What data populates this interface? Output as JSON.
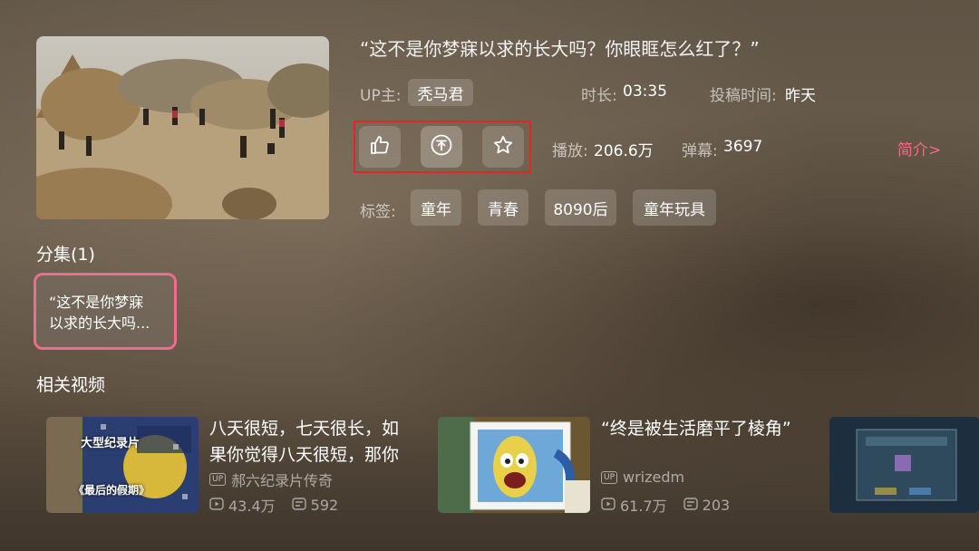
{
  "video": {
    "title": "“这不是你梦寐以求的长大吗？你眼眶怎么红了？”",
    "up_label": "UP主:",
    "up_name": "秃马君",
    "duration_label": "时长:",
    "duration": "03:35",
    "posted_label": "投稿时间:",
    "posted": "昨天",
    "plays_label": "播放:",
    "plays": "206.6万",
    "danmaku_label": "弹幕:",
    "danmaku": "3697",
    "intro_link": "简介>",
    "tags_label": "标签:",
    "tags": [
      "童年",
      "青春",
      "8090后",
      "童年玩具"
    ]
  },
  "actions": {
    "like_icon": "thumbs-up-icon",
    "coin_icon": "coin-icon",
    "favorite_icon": "star-icon"
  },
  "episodes": {
    "title": "分集(1)",
    "items": [
      {
        "line1": "“这不是你梦寐",
        "line2": "以求的长大吗..."
      }
    ]
  },
  "related": {
    "title": "相关视频",
    "items": [
      {
        "title_line1": "八天很短，七天很长，如",
        "title_line2": "果你觉得八天很短，那你",
        "up": "郝六纪录片传奇",
        "plays": "43.4万",
        "danmaku": "592",
        "thumb_text1": "大型纪录片",
        "thumb_text2": "《最后的假期》"
      },
      {
        "title_line1": "“终是被生活磨平了棱角”",
        "up": "wrizedm",
        "plays": "61.7万",
        "danmaku": "203"
      }
    ]
  },
  "colors": {
    "focus_pink": "#f06b8d",
    "highlight_red": "#e0262a"
  }
}
